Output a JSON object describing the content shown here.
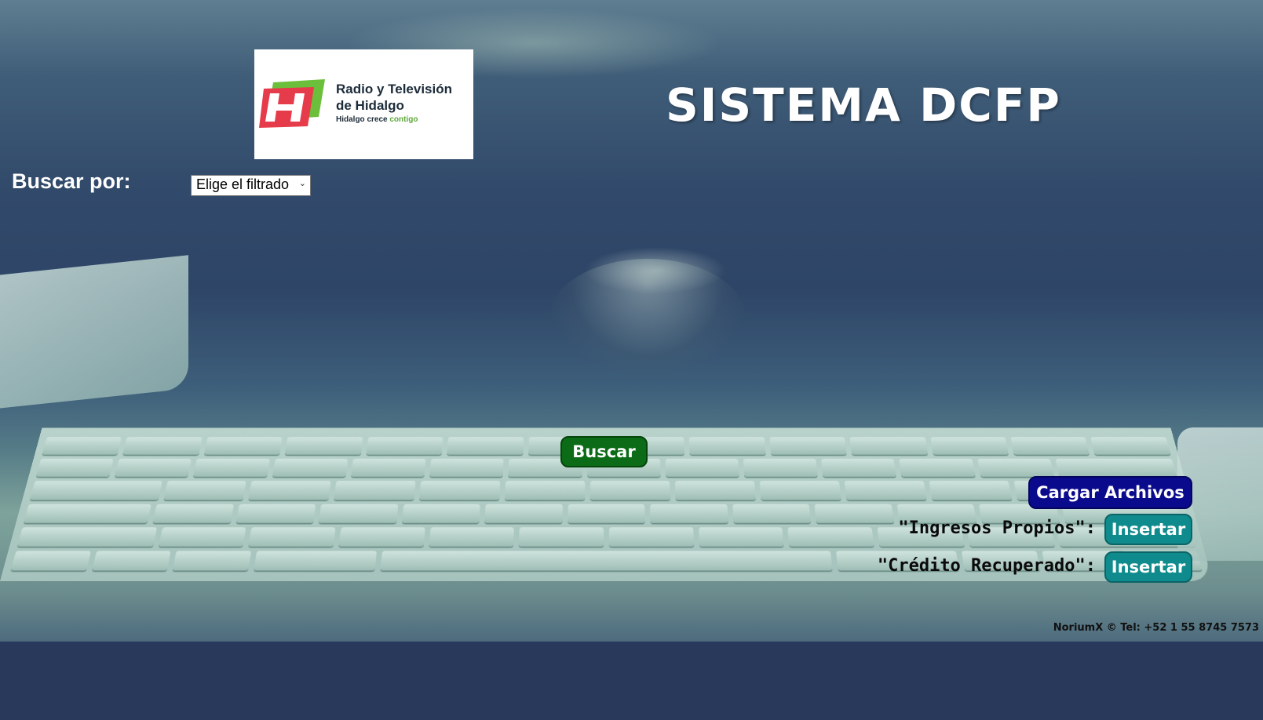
{
  "header": {
    "logo": {
      "title": "Radio y Televisión de Hidalgo",
      "tagline_prefix": "Hidalgo crece",
      "tagline_accent": "contigo",
      "brand_colors": {
        "green": "#5ea83b",
        "red": "#e63b4a",
        "dark": "#1c2b39"
      }
    },
    "app_title": "SISTEMA DCFP"
  },
  "filter": {
    "label": "Buscar por:",
    "select_value": "Elige el filtrado"
  },
  "actions": {
    "search_label": "Buscar",
    "upload_label": "Cargar Archivos",
    "rows": [
      {
        "label": "\"Ingresos Propios\":",
        "button": "Insertar"
      },
      {
        "label": "\"Crédito Recuperado\":",
        "button": "Insertar"
      }
    ]
  },
  "footer": {
    "text": "NoriumX © Tel: +52 1 55 8745 7573"
  },
  "colors": {
    "search_button": "#0b6b17",
    "upload_button": "#0a0a8c",
    "insert_button": "#0f8b8d",
    "page_bottom": "#29395c"
  }
}
